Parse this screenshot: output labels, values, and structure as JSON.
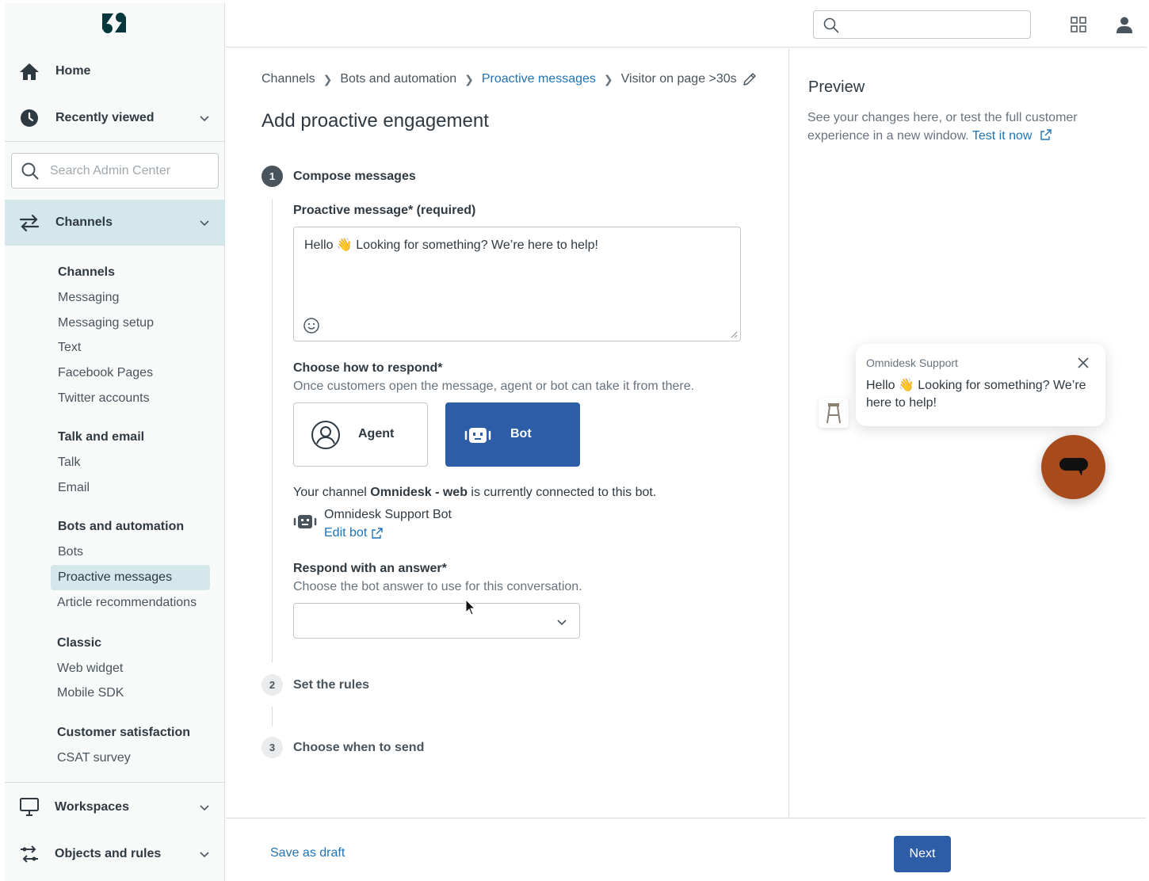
{
  "sidebar": {
    "home_label": "Home",
    "recent_label": "Recently viewed",
    "search_placeholder": "Search Admin Center",
    "channels_label": "Channels",
    "groups": [
      {
        "head": "Channels",
        "items": [
          "Messaging",
          "Messaging setup",
          "Text",
          "Facebook Pages",
          "Twitter accounts"
        ]
      },
      {
        "head": "Talk and email",
        "items": [
          "Talk",
          "Email"
        ]
      },
      {
        "head": "Bots and automation",
        "items": [
          "Bots",
          "Proactive messages",
          "Article recommendations"
        ]
      },
      {
        "head": "Classic",
        "items": [
          "Web widget",
          "Mobile SDK"
        ]
      },
      {
        "head": "Customer satisfaction",
        "items": [
          "CSAT survey"
        ]
      }
    ],
    "workspaces_label": "Workspaces",
    "objects_label": "Objects and rules"
  },
  "breadcrumb": {
    "items": [
      "Channels",
      "Bots and automation",
      "Proactive messages",
      "Visitor on page >30s"
    ]
  },
  "page": {
    "title": "Add proactive engagement"
  },
  "steps": [
    {
      "number": "1",
      "label": "Compose messages"
    },
    {
      "number": "2",
      "label": "Set the rules"
    },
    {
      "number": "3",
      "label": "Choose when to send"
    }
  ],
  "compose": {
    "message_label": "Proactive message* (required)",
    "message_value": "Hello 👋 Looking for something? We’re here to help!",
    "respond_label": "Choose how to respond*",
    "respond_hint": "Once customers open the message, agent or bot can take it from there.",
    "agent_label": "Agent",
    "bot_label": "Bot",
    "channel_note_pre": "Your channel ",
    "channel_name": "Omnidesk - web",
    "channel_note_post": " is currently connected to this bot.",
    "bot_name": "Omnidesk Support Bot",
    "edit_bot": "Edit bot",
    "answer_label": "Respond with an answer*",
    "answer_hint": "Choose the bot answer to use for this conversation.",
    "answer_value": ""
  },
  "preview": {
    "title": "Preview",
    "desc": "See your changes here, or test the full customer experience in a new window.",
    "test_link": "Test it now",
    "sender": "Omnidesk Support",
    "message": "Hello 👋 Looking for something? We’re here to help!"
  },
  "footer": {
    "save_draft": "Save as draft",
    "next": "Next"
  },
  "colors": {
    "primary": "#2e5da8",
    "link": "#1f73b7",
    "active_nav": "#d4e7ea",
    "launcher": "#a74a1c"
  }
}
